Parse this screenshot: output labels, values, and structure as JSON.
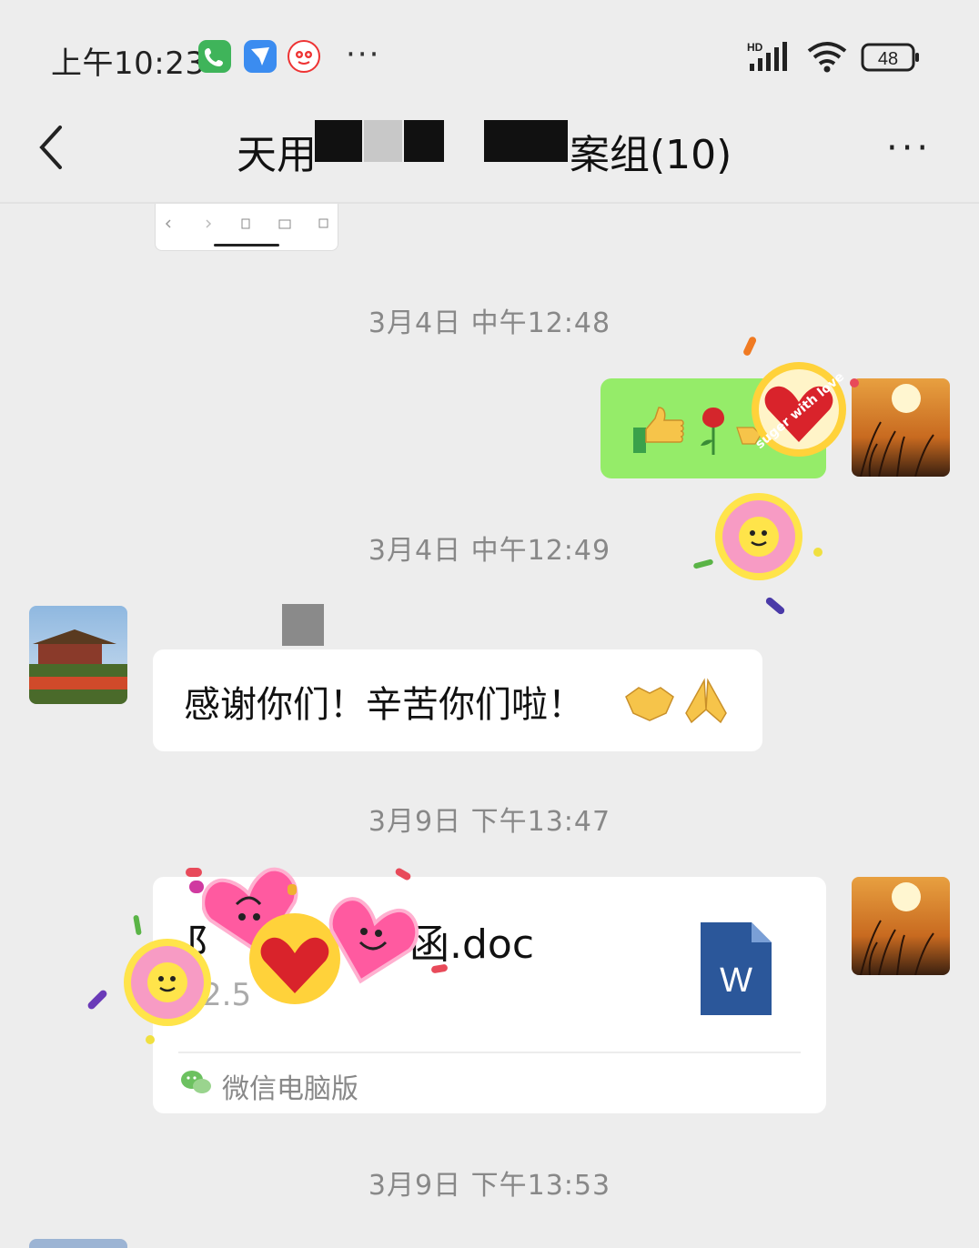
{
  "status_bar": {
    "time": "上午10:23",
    "hd_label": "HD",
    "battery": "48",
    "overflow": "···"
  },
  "nav": {
    "title_prefix": "天用",
    "title_suffix": "案组(10)",
    "more": "···"
  },
  "messages": {
    "ts1": "3月4日 中午12:48",
    "ts2": "3月4日 中午12:49",
    "ts3": "3月9日 下午13:47",
    "ts4": "3月9日 下午13:53",
    "incoming_text": "感谢你们！辛苦你们啦！",
    "file_name": "函.doc",
    "file_name_prefix": "阝",
    "file_size": "2.5",
    "file_source": "微信电脑版",
    "word_letter": "W"
  },
  "stickers": {
    "sticker_text": "suger with love"
  },
  "colors": {
    "background": "#ededed",
    "sent_bubble": "#95ec69",
    "received_bubble": "#ffffff",
    "word_blue": "#2b579a"
  }
}
